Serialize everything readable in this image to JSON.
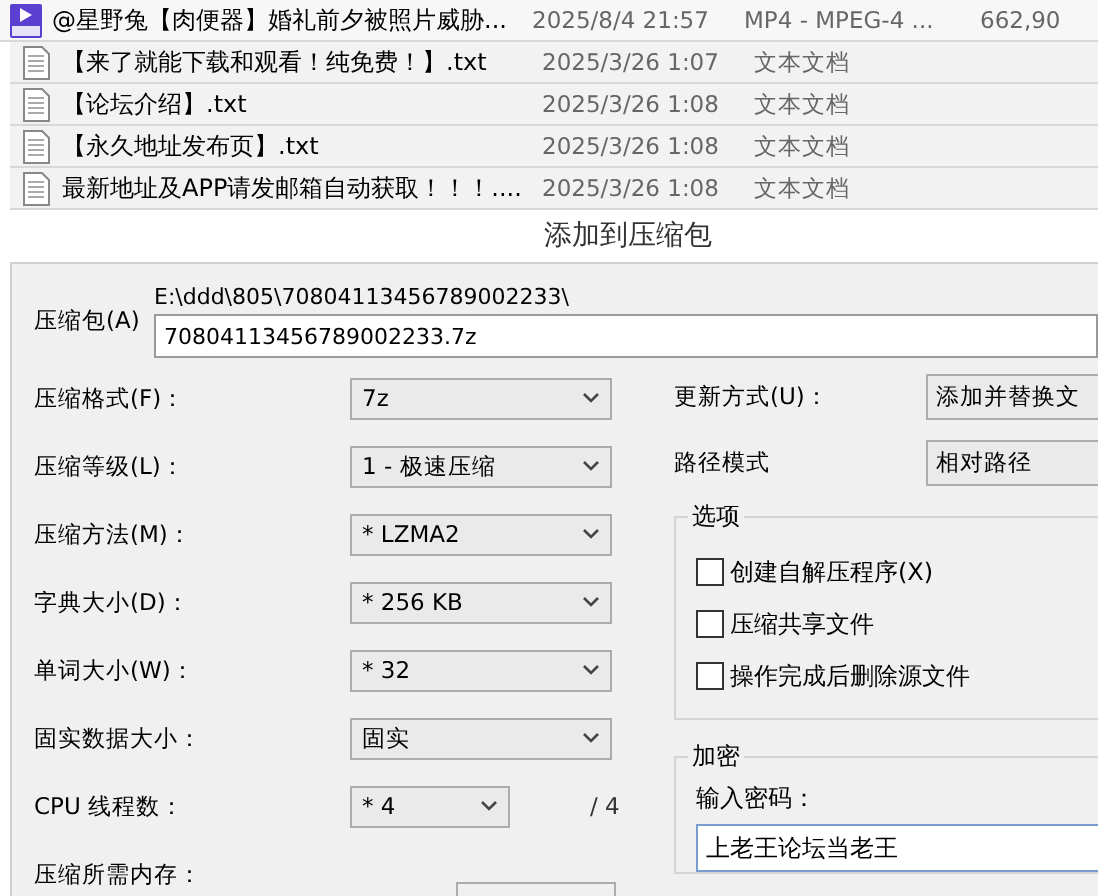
{
  "files": [
    {
      "kind": "video",
      "name": "@星野兔【肉便器】婚礼前夕被照片威胁...",
      "date": "2025/8/4 21:57",
      "type": "MP4 - MPEG-4 ...",
      "size": "662,90"
    },
    {
      "kind": "text",
      "name": "【来了就能下载和观看！纯免费！】.txt",
      "date": "2025/3/26 1:07",
      "type": "文本文档"
    },
    {
      "kind": "text",
      "name": "【论坛介绍】.txt",
      "date": "2025/3/26 1:08",
      "type": "文本文档"
    },
    {
      "kind": "text",
      "name": "【永久地址发布页】.txt",
      "date": "2025/3/26 1:08",
      "type": "文本文档"
    },
    {
      "kind": "text",
      "name": "最新地址及APP请发邮箱自动获取！！！....",
      "date": "2025/3/26 1:08",
      "type": "文本文档"
    }
  ],
  "dialog": {
    "title": "添加到压缩包",
    "archive": {
      "label": "压缩包(A)",
      "path": "E:\\ddd\\805\\70804113456789002233\\",
      "value": "70804113456789002233.7z"
    },
    "settings": [
      {
        "kind": "select",
        "label": "压缩格式(F)：",
        "value": "7z"
      },
      {
        "kind": "select",
        "label": "压缩等级(L)：",
        "value": "1 - 极速压缩"
      },
      {
        "kind": "select",
        "label": "压缩方法(M)：",
        "value": "* LZMA2"
      },
      {
        "kind": "select",
        "label": "字典大小(D)：",
        "value": "* 256 KB"
      },
      {
        "kind": "select",
        "label": "单词大小(W)：",
        "value": "* 32"
      },
      {
        "kind": "select",
        "label": "固实数据大小：",
        "value": "固实"
      },
      {
        "kind": "short",
        "label": "CPU 线程数：",
        "value": "* 4",
        "suffix": "/ 4"
      },
      {
        "kind": "readout",
        "label": "压缩所需内存："
      }
    ],
    "update_mode": {
      "label": "更新方式(U)：",
      "value": "添加并替换文"
    },
    "path_mode": {
      "label": "路径模式",
      "value": "相对路径"
    },
    "options": {
      "title": "选项",
      "items": [
        {
          "label": "创建自解压程序(X)",
          "checked": false
        },
        {
          "label": "压缩共享文件",
          "checked": false
        },
        {
          "label": "操作完成后删除源文件",
          "checked": false
        }
      ]
    },
    "encryption": {
      "title": "加密",
      "password_label": "输入密码：",
      "password_value": "上老王论坛当老王"
    }
  }
}
